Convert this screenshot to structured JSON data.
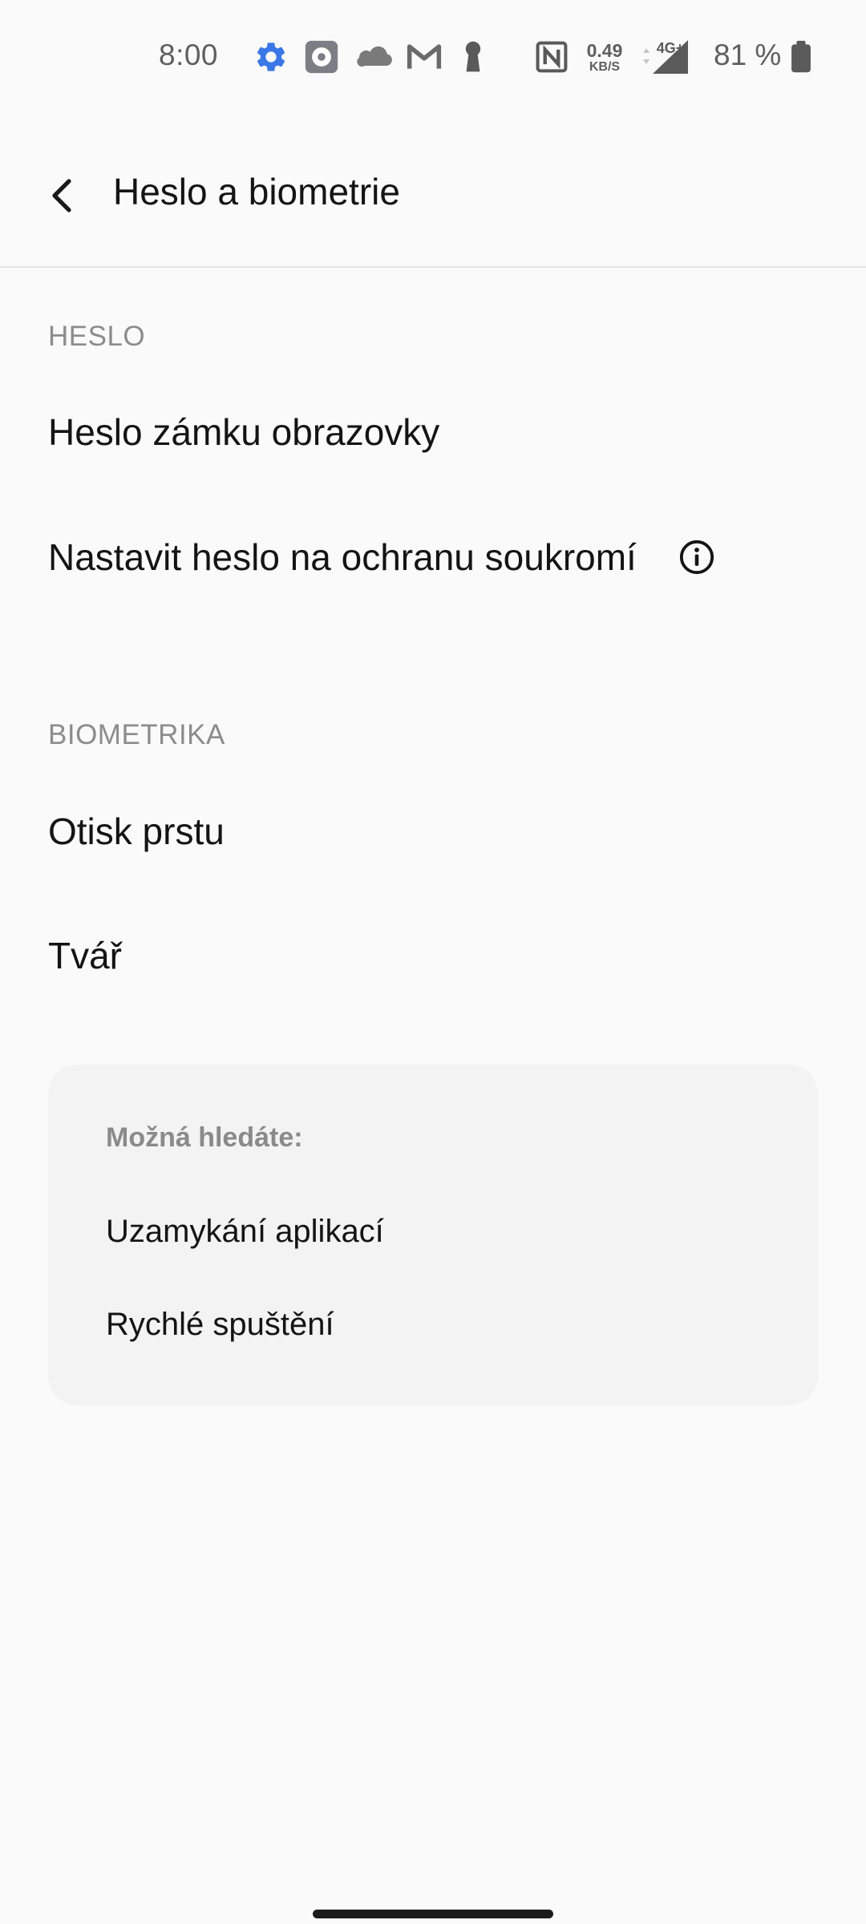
{
  "status_bar": {
    "time": "8:00",
    "net_speed_value": "0.49",
    "net_speed_unit": "KB/S",
    "network_label": "4G+",
    "battery_text": "81 %",
    "icons": [
      "settings-gear-icon",
      "settings-app-icon",
      "onedrive-cloud-icon",
      "gmail-icon",
      "keyhole-icon",
      "nfc-icon",
      "signal-icon",
      "battery-icon"
    ],
    "colors": {
      "gear": "#3b78e7",
      "icon_gray": "#606060"
    }
  },
  "header": {
    "back_icon": "chevron-left-icon",
    "title": "Heslo a biometrie"
  },
  "sections": {
    "password": {
      "header": "HESLO",
      "items": [
        {
          "label": "Heslo zámku obrazovky"
        },
        {
          "label": "Nastavit heslo na ochranu soukromí",
          "icon": "info-icon"
        }
      ]
    },
    "biometrics": {
      "header": "BIOMETRIKA",
      "items": [
        {
          "label": "Otisk prstu"
        },
        {
          "label": "Tvář"
        }
      ]
    }
  },
  "suggestions": {
    "title": "Možná hledáte:",
    "items": [
      {
        "label": "Uzamykání aplikací"
      },
      {
        "label": "Rychlé spuštění"
      }
    ]
  }
}
